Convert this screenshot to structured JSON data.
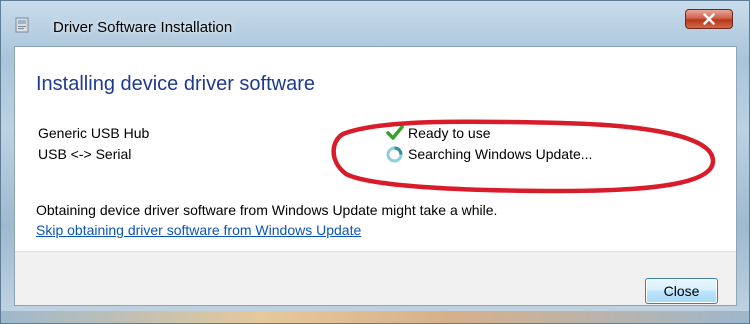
{
  "window": {
    "title": "Driver Software Installation",
    "close_glyph": "x"
  },
  "main": {
    "heading": "Installing device driver software",
    "devices": [
      {
        "name": "Generic USB Hub",
        "status": "Ready to use",
        "status_icon": "checkmark-icon"
      },
      {
        "name": "USB <-> Serial",
        "status": "Searching Windows Update...",
        "status_icon": "spinner-icon"
      }
    ],
    "info_text": "Obtaining device driver software from Windows Update might take a while.",
    "skip_link": "Skip obtaining driver software from Windows Update"
  },
  "footer": {
    "close_label": "Close"
  },
  "colors": {
    "heading": "#1e3a8c",
    "link": "#0b55b6",
    "annotation_ellipse": "#d81c2a",
    "check_green": "#3aa02c"
  }
}
